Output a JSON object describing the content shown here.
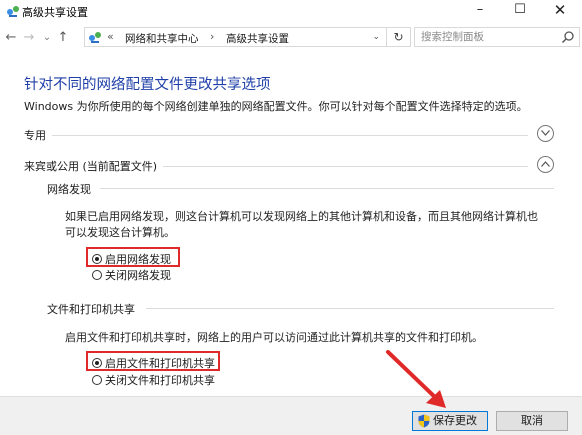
{
  "window": {
    "title": "高级共享设置",
    "minimize": "–",
    "maximize": "☐",
    "close": "✕"
  },
  "nav": {
    "back": "←",
    "forward": "→",
    "recent": "⌄",
    "up": "↑",
    "address": {
      "overflow": "«",
      "crumbs": [
        "网络和共享中心",
        "高级共享设置"
      ],
      "separator": "›",
      "dropdown": "⌄"
    },
    "refresh": "↻",
    "search_placeholder": "搜索控制面板"
  },
  "content": {
    "heading": "针对不同的网络配置文件更改共享选项",
    "subtitle": "Windows 为你所使用的每个网络创建单独的网络配置文件。你可以针对每个配置文件选择特定的选项。",
    "sections": [
      {
        "label": "专用",
        "expanded": false
      },
      {
        "label": "来宾或公用 (当前配置文件)",
        "expanded": true
      }
    ],
    "network_discovery": {
      "title": "网络发现",
      "desc_line1": "如果已启用网络发现，则这台计算机可以发现网络上的其他计算机和设备，而且其他网络计算机也",
      "desc_line2": "可以发现这台计算机。",
      "options": [
        {
          "label": "启用网络发现",
          "checked": true
        },
        {
          "label": "关闭网络发现",
          "checked": false
        }
      ]
    },
    "file_printer_sharing": {
      "title": "文件和打印机共享",
      "desc": "启用文件和打印机共享时，网络上的用户可以访问通过此计算机共享的文件和打印机。",
      "options": [
        {
          "label": "启用文件和打印机共享",
          "checked": true
        },
        {
          "label": "关闭文件和打印机共享",
          "checked": false
        }
      ]
    }
  },
  "footer": {
    "save_label": "保存更改",
    "cancel_label": "取消"
  },
  "colors": {
    "heading": "#1e3fa8",
    "highlight": "#e02a2a",
    "save_border": "#0078d7"
  }
}
